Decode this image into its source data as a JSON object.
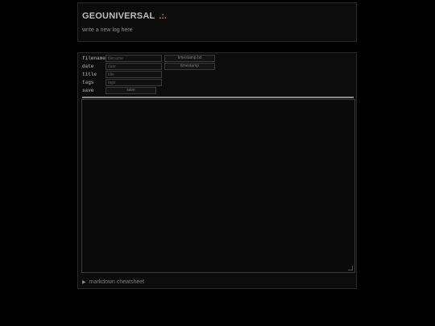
{
  "header": {
    "site_title": "GEOUNIVERSAL",
    "title_mark": ".:.",
    "subtitle": "write a new log here"
  },
  "form": {
    "filename": {
      "label": "filename",
      "placeholder": "filename",
      "side_button": "timestamp.txt"
    },
    "date": {
      "label": "date",
      "placeholder": "date",
      "side_button": "timestamp"
    },
    "title": {
      "label": "title",
      "placeholder": "title"
    },
    "tags": {
      "label": "tags",
      "placeholder": "tags"
    },
    "save": {
      "label": "save",
      "button": "save"
    }
  },
  "editor": {
    "value": ""
  },
  "cheatsheet": {
    "icon": "triangle-right-icon",
    "glyph": "▶",
    "label": "markdown cheatsheet"
  },
  "colors": {
    "accent": "#d9a300",
    "background": "#000000",
    "panel": "#0c0c0c"
  }
}
